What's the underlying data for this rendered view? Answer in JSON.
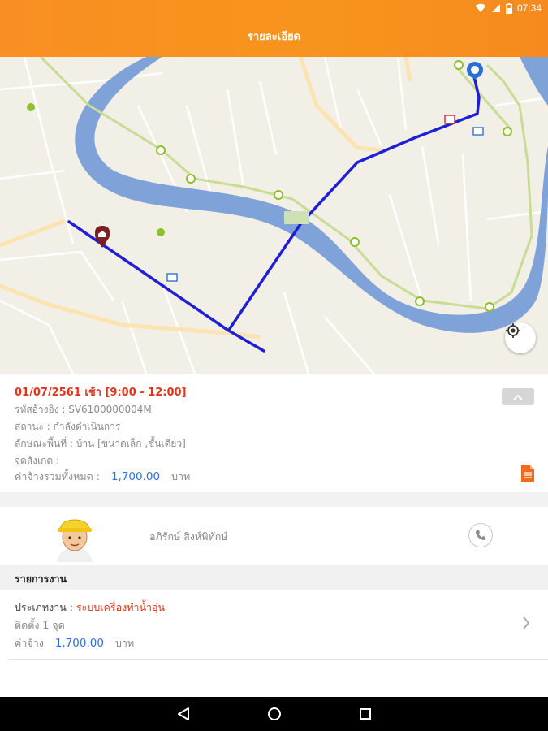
{
  "status_bar": {
    "time": "07:34"
  },
  "header": {
    "title": "รายละเอียด"
  },
  "booking": {
    "date_time": "01/07/2561 เช้า [9:00 - 12:00]",
    "reference": "รหัสอ้างอิง : SV6100000004M",
    "status": "สถานะ : กำลังดำเนินการ",
    "area_type": "ลักษณะพื้นที่ : บ้าน [ขนาดเล็ก ,ชั้นเดียว]",
    "landmark": "จุดสังเกต :",
    "total_label": "ค่าจ้างรวมทั้งหมด :",
    "total_amount": "1,700.00",
    "total_unit": "บาท"
  },
  "technician": {
    "name": "อภิรักษ์ สิงห์พิทักษ์"
  },
  "jobs_section": {
    "title": "รายการงาน"
  },
  "job": {
    "type_label": "ประเภทงาน :",
    "type_value": "ระบบเครื่องทำน้ำอุ่น",
    "quantity": "ติดตั้ง 1 จุด",
    "fee_label": "ค่าจ้าง",
    "fee_amount": "1,700.00",
    "fee_unit": "บาท"
  },
  "colors": {
    "header": "#f7941d",
    "accent_red": "#e2341d",
    "accent_blue": "#2d6fe0",
    "route": "#1f1fd6",
    "river": "#7fa3d8"
  },
  "icons": [
    "wifi-icon",
    "signal-icon",
    "battery-icon",
    "home-marker-icon",
    "technician-marker-icon",
    "locate-icon",
    "chevron-up-icon",
    "document-icon",
    "phone-icon",
    "chevron-right-icon",
    "back-icon",
    "home-icon",
    "recents-icon"
  ]
}
